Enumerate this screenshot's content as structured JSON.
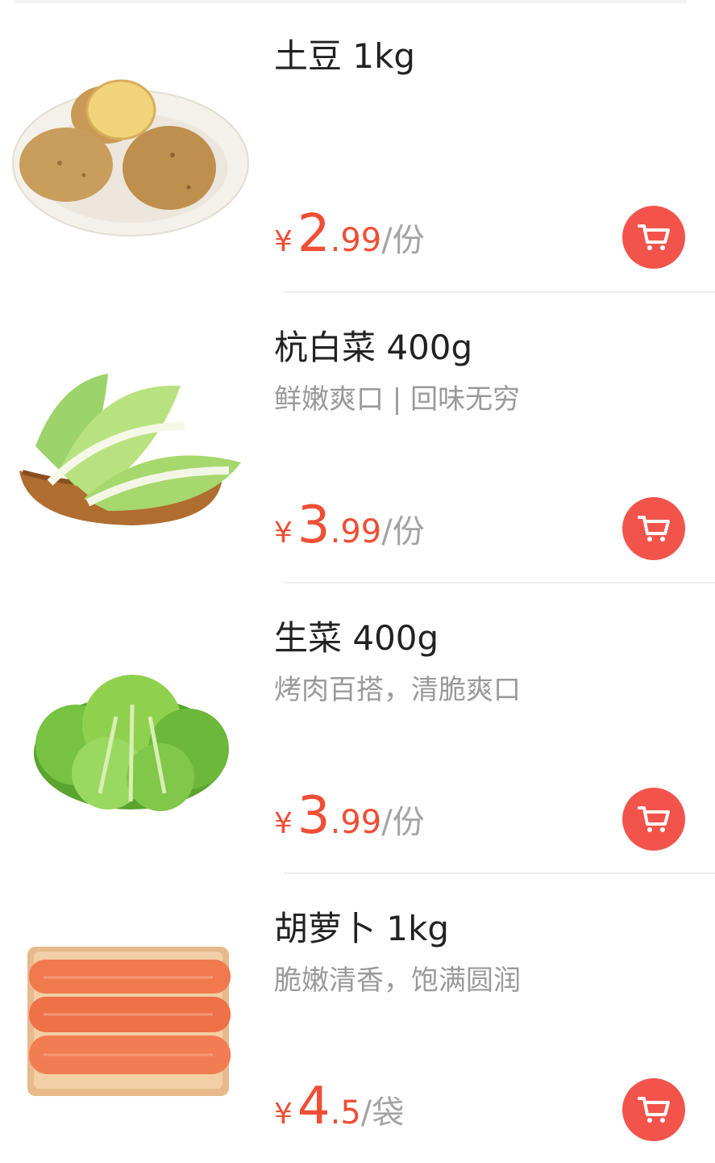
{
  "products": [
    {
      "name": "土豆 1kg",
      "desc": "",
      "currency": "¥",
      "price_int": "2",
      "price_dec": ".99",
      "unit": "/份",
      "cart_icon": "shopping-cart-icon"
    },
    {
      "name": "杭白菜 400g",
      "desc": "鲜嫩爽口 | 回味无穷",
      "currency": "¥",
      "price_int": "3",
      "price_dec": ".99",
      "unit": "/份",
      "cart_icon": "shopping-cart-icon"
    },
    {
      "name": "生菜 400g",
      "desc": "烤肉百搭，清脆爽口",
      "currency": "¥",
      "price_int": "3",
      "price_dec": ".99",
      "unit": "/份",
      "cart_icon": "shopping-cart-icon"
    },
    {
      "name": "胡萝卜 1kg",
      "desc": "脆嫩清香，饱满圆润",
      "currency": "¥",
      "price_int": "4",
      "price_dec": ".5",
      "unit": "/袋",
      "cart_icon": "shopping-cart-icon"
    }
  ],
  "colors": {
    "price": "#f04e36",
    "cart": "#f2544c",
    "unit": "#a4a4a4",
    "desc": "#9a9a9a"
  }
}
